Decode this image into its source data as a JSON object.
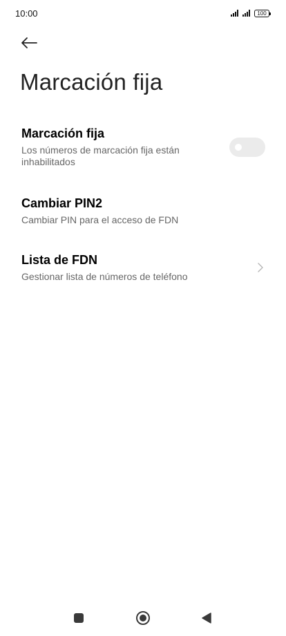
{
  "status_bar": {
    "time": "10:00",
    "battery": "100",
    "icons": [
      "signal-icon",
      "signal-icon",
      "battery-icon"
    ]
  },
  "header": {
    "back_icon": "arrow-left-icon",
    "title": "Marcación fija"
  },
  "settings": {
    "fixed_dialing": {
      "title": "Marcación fija",
      "subtitle": "Los números de marcación fija están inhabilitados",
      "enabled": false
    },
    "change_pin2": {
      "title": "Cambiar PIN2",
      "subtitle": "Cambiar PIN para el acceso de FDN"
    },
    "fdn_list": {
      "title": "Lista de FDN",
      "subtitle": "Gestionar lista de números de teléfono",
      "icon": "chevron-right-icon"
    }
  },
  "nav_bar": {
    "icons": [
      "recents-icon",
      "home-icon",
      "back-icon"
    ]
  },
  "colors": {
    "toggle_off": "#ebebeb",
    "subtitle": "#666666",
    "title": "#222222"
  }
}
